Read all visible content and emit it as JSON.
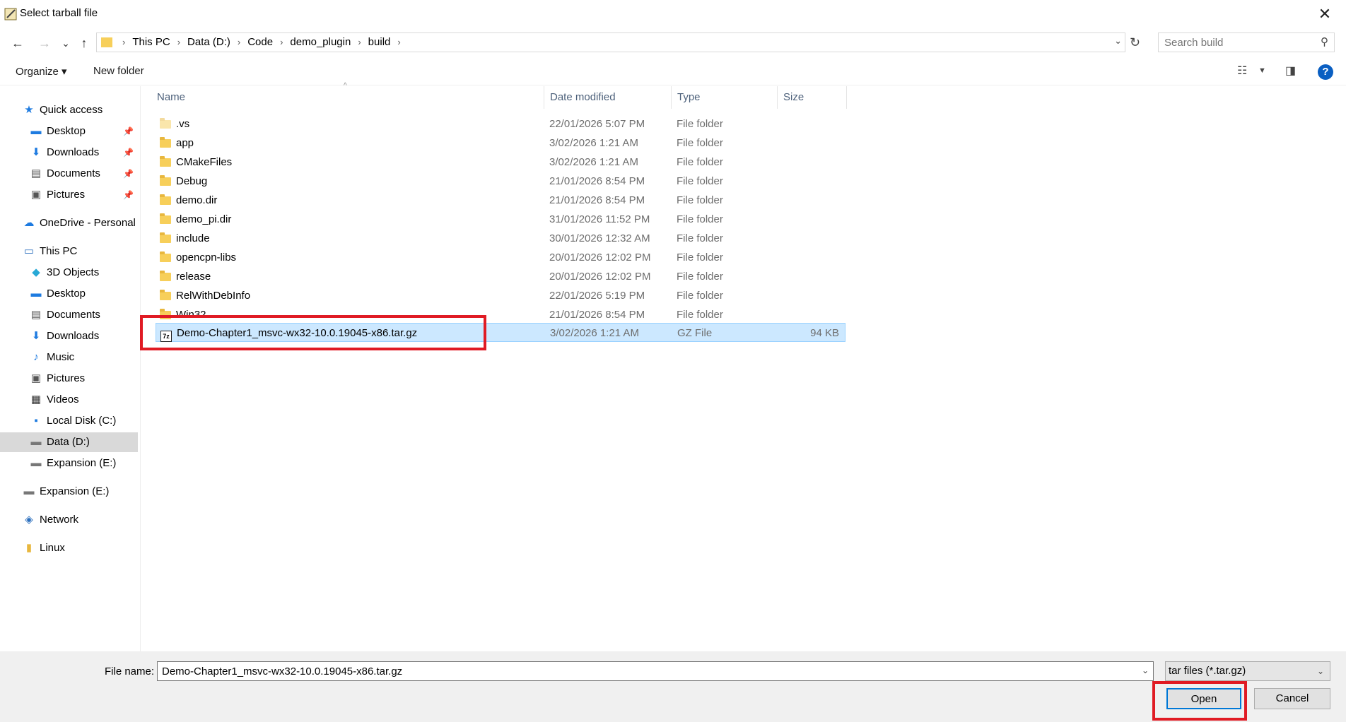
{
  "window": {
    "title": "Select tarball file"
  },
  "nav": {
    "back_icon": "←",
    "forward_icon": "→",
    "recent_icon": "⌄",
    "up_icon": "↑",
    "breadcrumbs": [
      "This PC",
      "Data (D:)",
      "Code",
      "demo_plugin",
      "build"
    ],
    "search_placeholder": "Search build"
  },
  "commands": {
    "organize": "Organize ▾",
    "new_folder": "New folder"
  },
  "sidebar": {
    "items": [
      {
        "label": "Quick access",
        "icon": "★"
      },
      {
        "label": "Desktop",
        "icon": "▬"
      },
      {
        "label": "Downloads",
        "icon": "⬇"
      },
      {
        "label": "Documents",
        "icon": "▤"
      },
      {
        "label": "Pictures",
        "icon": "▣"
      },
      {
        "label": "OneDrive - Personal",
        "icon": "☁"
      },
      {
        "label": "This PC",
        "icon": "▭"
      },
      {
        "label": "3D Objects",
        "icon": "◆"
      },
      {
        "label": "Desktop",
        "icon": "▬"
      },
      {
        "label": "Documents",
        "icon": "▤"
      },
      {
        "label": "Downloads",
        "icon": "⬇"
      },
      {
        "label": "Music",
        "icon": "♪"
      },
      {
        "label": "Pictures",
        "icon": "▣"
      },
      {
        "label": "Videos",
        "icon": "▦"
      },
      {
        "label": "Local Disk (C:)",
        "icon": "▪"
      },
      {
        "label": "Data (D:)",
        "icon": "▬"
      },
      {
        "label": "Expansion (E:)",
        "icon": "▬"
      },
      {
        "label": "Expansion (E:)",
        "icon": "▬"
      },
      {
        "label": "Network",
        "icon": "◈"
      },
      {
        "label": "Linux",
        "icon": "▮"
      }
    ]
  },
  "columns": {
    "name": "Name",
    "date": "Date modified",
    "type": "Type",
    "size": "Size"
  },
  "files": [
    {
      "name": ".vs",
      "date": "22/01/2026 5:07 PM",
      "type": "File folder",
      "size": ""
    },
    {
      "name": "app",
      "date": "3/02/2026 1:21 AM",
      "type": "File folder",
      "size": ""
    },
    {
      "name": "CMakeFiles",
      "date": "3/02/2026 1:21 AM",
      "type": "File folder",
      "size": ""
    },
    {
      "name": "Debug",
      "date": "21/01/2026 8:54 PM",
      "type": "File folder",
      "size": ""
    },
    {
      "name": "demo.dir",
      "date": "21/01/2026 8:54 PM",
      "type": "File folder",
      "size": ""
    },
    {
      "name": "demo_pi.dir",
      "date": "31/01/2026 11:52 PM",
      "type": "File folder",
      "size": ""
    },
    {
      "name": "include",
      "date": "30/01/2026 12:32 AM",
      "type": "File folder",
      "size": ""
    },
    {
      "name": "opencpn-libs",
      "date": "20/01/2026 12:02 PM",
      "type": "File folder",
      "size": ""
    },
    {
      "name": "release",
      "date": "20/01/2026 12:02 PM",
      "type": "File folder",
      "size": ""
    },
    {
      "name": "RelWithDebInfo",
      "date": "22/01/2026 5:19 PM",
      "type": "File folder",
      "size": ""
    },
    {
      "name": "Win32",
      "date": "21/01/2026 8:54 PM",
      "type": "File folder",
      "size": ""
    },
    {
      "name": "Demo-Chapter1_msvc-wx32-10.0.19045-x86.tar.gz",
      "date": "3/02/2026 1:21 AM",
      "type": "GZ File",
      "size": "94 KB"
    }
  ],
  "gz_icon_text": "7z",
  "footer": {
    "filename_label": "File name:",
    "filename_value": "Demo-Chapter1_msvc-wx32-10.0.19045-x86.tar.gz",
    "filter": "tar files (*.tar.gz)",
    "open": "Open",
    "cancel": "Cancel"
  },
  "colors": {
    "accent": "#0078d7",
    "selection": "#cce8ff",
    "annotation": "#e01b24"
  }
}
